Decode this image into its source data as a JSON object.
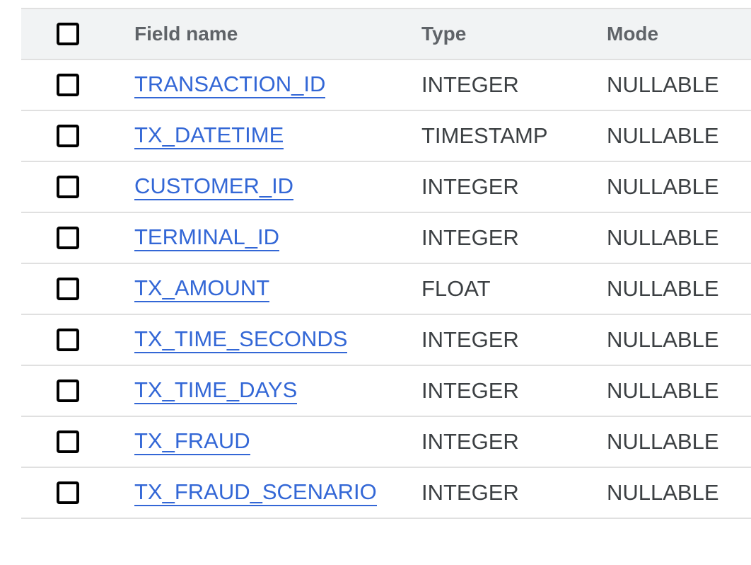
{
  "table": {
    "headers": {
      "field_name": "Field name",
      "type": "Type",
      "mode": "Mode"
    },
    "rows": [
      {
        "name": "TRANSACTION_ID",
        "type": "INTEGER",
        "mode": "NULLABLE"
      },
      {
        "name": "TX_DATETIME",
        "type": "TIMESTAMP",
        "mode": "NULLABLE"
      },
      {
        "name": "CUSTOMER_ID",
        "type": "INTEGER",
        "mode": "NULLABLE"
      },
      {
        "name": "TERMINAL_ID",
        "type": "INTEGER",
        "mode": "NULLABLE"
      },
      {
        "name": "TX_AMOUNT",
        "type": "FLOAT",
        "mode": "NULLABLE"
      },
      {
        "name": "TX_TIME_SECONDS",
        "type": "INTEGER",
        "mode": "NULLABLE"
      },
      {
        "name": "TX_TIME_DAYS",
        "type": "INTEGER",
        "mode": "NULLABLE"
      },
      {
        "name": "TX_FRAUD",
        "type": "INTEGER",
        "mode": "NULLABLE"
      },
      {
        "name": "TX_FRAUD_SCENARIO",
        "type": "INTEGER",
        "mode": "NULLABLE"
      }
    ]
  },
  "colors": {
    "link": "#3367d6",
    "header_bg": "#f1f3f4",
    "divider": "#e0e0e0",
    "text": "#3c4043"
  }
}
